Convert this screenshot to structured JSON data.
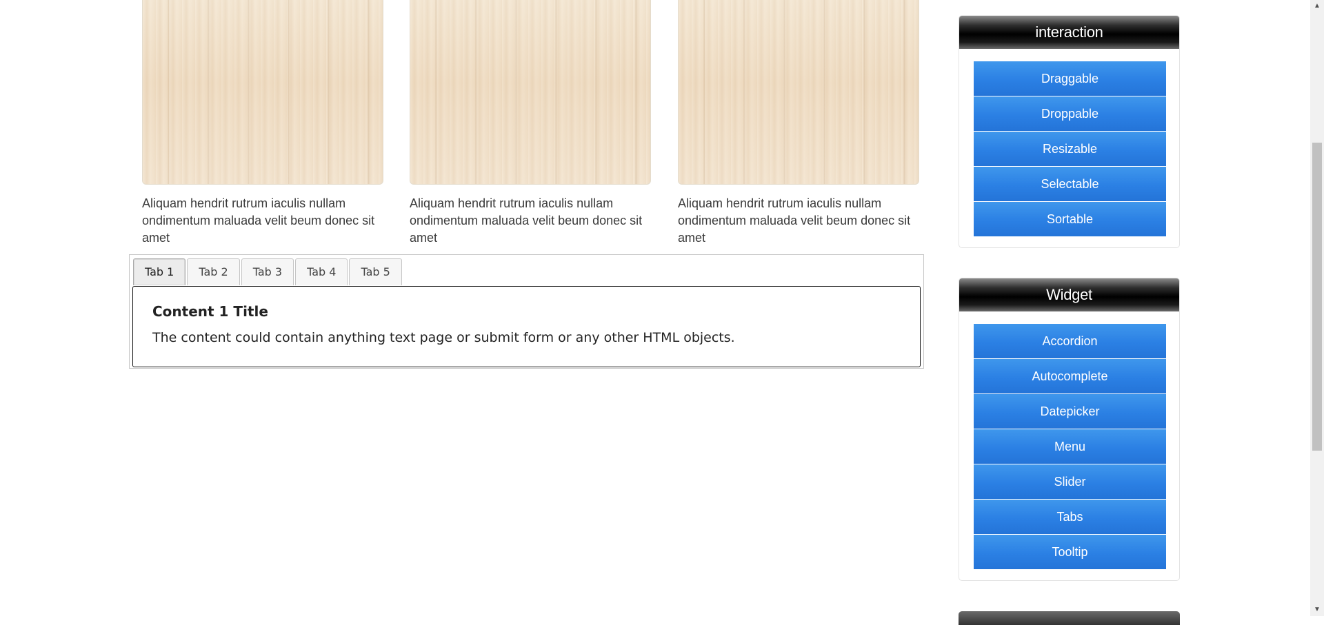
{
  "cards": [
    {
      "caption": "Aliquam hendrit rutrum iaculis nullam ondimentum maluada velit beum donec sit amet"
    },
    {
      "caption": "Aliquam hendrit rutrum iaculis nullam ondimentum maluada velit beum donec sit amet"
    },
    {
      "caption": "Aliquam hendrit rutrum iaculis nullam ondimentum maluada velit beum donec sit amet"
    }
  ],
  "tabs": {
    "items": [
      "Tab 1",
      "Tab 2",
      "Tab 3",
      "Tab 4",
      "Tab 5"
    ],
    "active_index": 0,
    "panel_title": "Content 1 Title",
    "panel_text": "The content could contain anything text page or submit form or any other HTML objects."
  },
  "sidebar": {
    "interaction": {
      "title": "interaction",
      "items": [
        "Draggable",
        "Droppable",
        "Resizable",
        "Selectable",
        "Sortable"
      ]
    },
    "widget": {
      "title": "Widget",
      "items": [
        "Accordion",
        "Autocomplete",
        "Datepicker",
        "Menu",
        "Slider",
        "Tabs",
        "Tooltip"
      ]
    }
  },
  "colors": {
    "button_blue": "#2b80e4",
    "header_black": "#000000"
  },
  "scrollbar": {
    "up_icon": "triangle-up",
    "down_icon": "triangle-down"
  }
}
